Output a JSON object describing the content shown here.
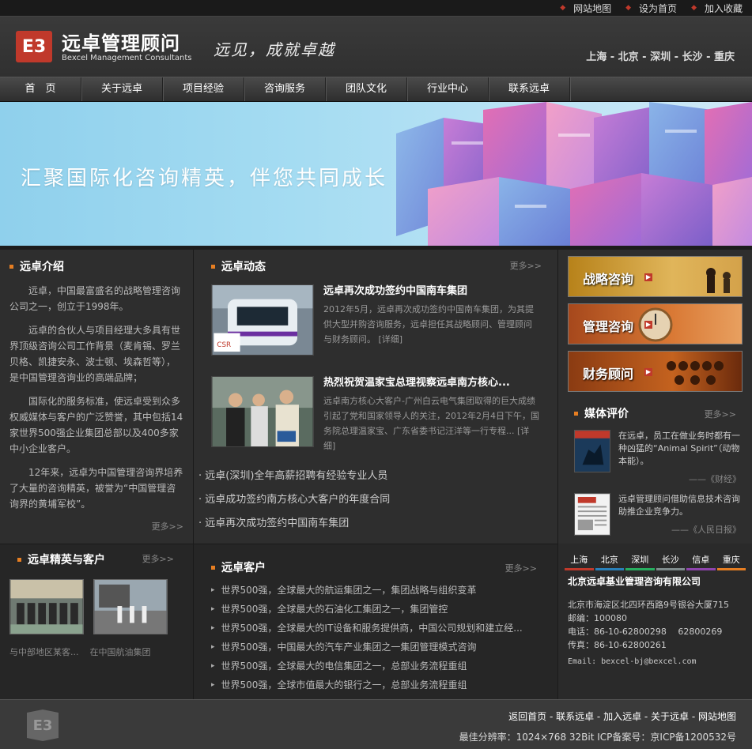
{
  "topbar": {
    "links": [
      "网站地图",
      "设为首页",
      "加入收藏"
    ]
  },
  "header": {
    "logo_mark": "E3",
    "name_cn": "远卓管理顾问",
    "name_en": "Bexcel Management Consultants",
    "slogan": "远见，成就卓越",
    "cities": "上海 - 北京 - 深圳 - 长沙 - 重庆"
  },
  "nav": [
    "首　页",
    "关于远卓",
    "项目经验",
    "咨询服务",
    "团队文化",
    "行业中心",
    "联系远卓"
  ],
  "banner": {
    "text": "汇聚国际化咨询精英，伴您共同成长"
  },
  "intro": {
    "title": "远卓介绍",
    "paragraphs": [
      "远卓，中国最富盛名的战略管理咨询公司之一，创立于1998年。",
      "远卓的合伙人与项目经理大多具有世界顶级咨询公司工作背景（麦肯锡、罗兰贝格、凯捷安永、波士顿、埃森哲等），是中国管理咨询业的高端品牌；",
      "国际化的服务标准，使远卓受到众多权威媒体与客户的广泛赞誉，其中包括14家世界500强企业集团总部以及400多家中小企业客户。",
      "12年来，远卓为中国管理咨询界培养了大量的咨询精英，被誉为“中国管理咨询界的黄埔军校”。"
    ],
    "more": "更多>>"
  },
  "news": {
    "title": "远卓动态",
    "more": "更多>>",
    "items": [
      {
        "title": "远卓再次成功签约中国南车集团",
        "desc": "2012年5月，远卓再次成功签约中国南车集团，为其提供大型并购咨询服务，远卓担任其战略顾问、管理顾问与财务顾问。 [详细]"
      },
      {
        "title": "热烈祝贺温家宝总理视察远卓南方核心...",
        "desc": "远卓南方核心大客户-广州白云电气集团取得的巨大成绩引起了党和国家领导人的关注，2012年2月4日下午，国务院总理温家宝、广东省委书记汪洋等一行专程... [详细]"
      }
    ],
    "links": [
      "远卓(深圳)全年高薪招聘有经验专业人员",
      "远卓成功签约南方核心大客户的年度合同",
      "远卓再次成功签约中国南车集团"
    ]
  },
  "services": [
    {
      "label": "战略咨询"
    },
    {
      "label": "管理咨询"
    },
    {
      "label": "财务顾问"
    }
  ],
  "media": {
    "title": "媒体评价",
    "more": "更多>>",
    "items": [
      {
        "text": "在远卓，员工在做业务时都有一种凶猛的“Animal Spirit”（动物本能）。",
        "source": "——《财经》"
      },
      {
        "text": "远卓管理顾问借助信息技术咨询助推企业竞争力。",
        "source": "——《人民日报》"
      }
    ]
  },
  "elite": {
    "title": "远卓精英与客户",
    "more": "更多>>",
    "captions": [
      "与中部地区某客...",
      "在中国航油集团"
    ]
  },
  "clients": {
    "title": "远卓客户",
    "more": "更多>>",
    "items": [
      "世界500强，全球最大的航运集团之一，集团战略与组织变革",
      "世界500强，全球最大的石油化工集团之一，集团管控",
      "世界500强，全球最大的IT设备和服务提供商，中国公司规划和建立经...",
      "世界500强，中国最大的汽车产业集团之一集团管理模式咨询",
      "世界500强，全球最大的电信集团之一，总部业务流程重组",
      "世界500强，全球市值最大的银行之一，总部业务流程重组"
    ]
  },
  "contact": {
    "tabs": [
      {
        "label": "上海",
        "color": "#c0392b"
      },
      {
        "label": "北京",
        "color": "#2980b9"
      },
      {
        "label": "深圳",
        "color": "#27ae60"
      },
      {
        "label": "长沙",
        "color": "#7f8c8d"
      },
      {
        "label": "信卓",
        "color": "#8e44ad"
      },
      {
        "label": "重庆",
        "color": "#e67e22"
      }
    ],
    "company": "北京远卓基业管理咨询有限公司",
    "address": "北京市海淀区北四环西路9号银谷大厦715",
    "postcode": "邮编：100080",
    "phone": "电话：86-10-62800298　 62800269",
    "fax": "传真：86-10-62800261",
    "email": "Email: bexcel-bj@bexcel.com"
  },
  "footer": {
    "logo_mark": "E3",
    "links": "返回首页 - 联系远卓 - 加入远卓 - 关于远卓 - 网站地图",
    "copyright": "最佳分辨率：1024×768 32Bit ICP备案号：京ICP备1200532号"
  },
  "colors": {
    "brand_red": "#c0392b",
    "accent_orange": "#e67e22",
    "background": "#2e2e2e"
  }
}
